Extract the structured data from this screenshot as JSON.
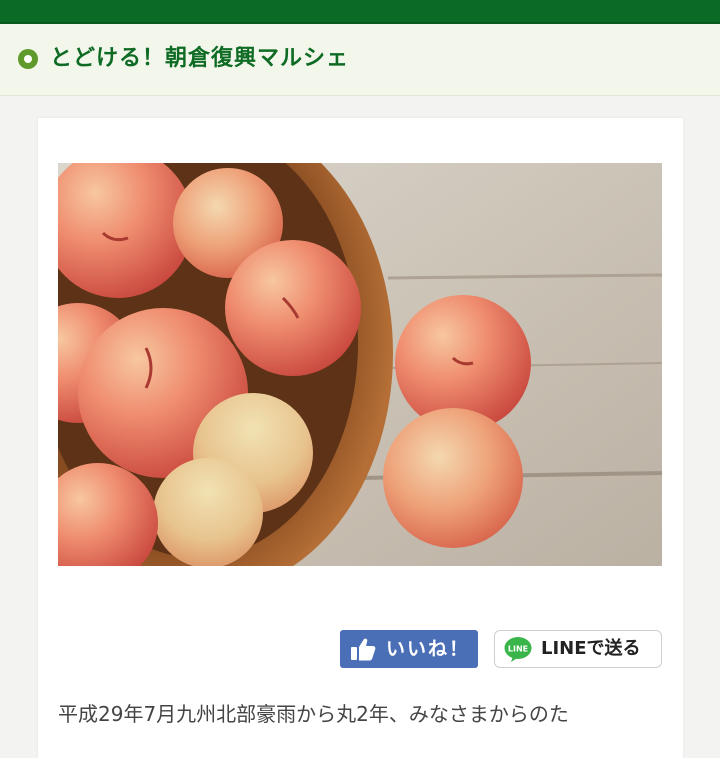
{
  "header": {
    "title": "とどける！朝倉復興マルシェ"
  },
  "image": {
    "subject": "peaches"
  },
  "social": {
    "like_label": "いいね！",
    "line_label": "LINEで送る",
    "line_icon_text": "LINE"
  },
  "article": {
    "intro": "平成29年7月九州北部豪雨から丸2年、みなさまからのた"
  },
  "colors": {
    "brand_green": "#0b6a25",
    "header_background": "#f3f6ea",
    "facebook_blue": "#4b6fb6",
    "line_green": "#3ab54a"
  },
  "icons": {
    "header": "circle-bullet-icon",
    "like": "thumbs-up-icon",
    "line": "line-logo-icon"
  }
}
